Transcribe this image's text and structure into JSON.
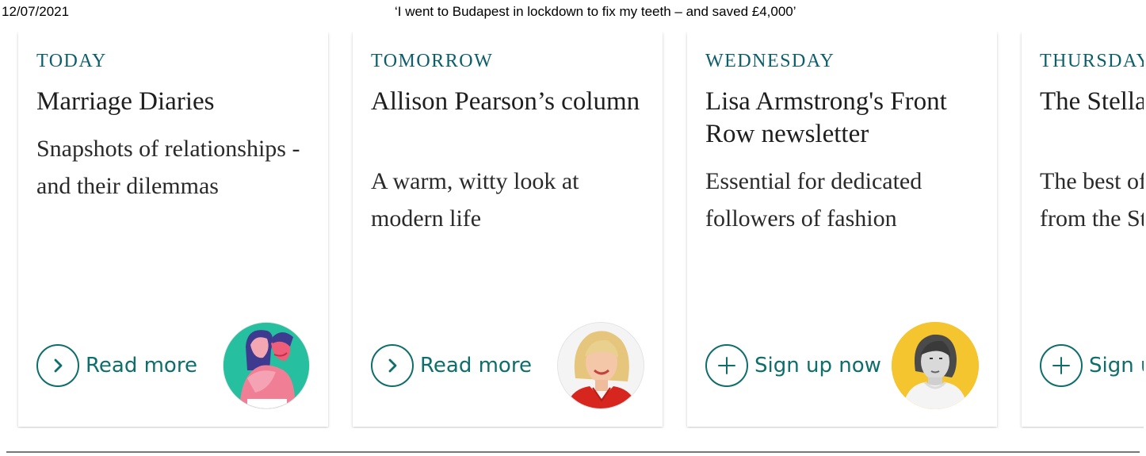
{
  "print_header": {
    "date": "12/07/2021",
    "title": "‘I went to Budapest in lockdown to fix my teeth – and saved £4,000’"
  },
  "cards": [
    {
      "day": "TODAY",
      "title": "Marriage Diaries",
      "description": "Snapshots of relationships - and their dilemmas",
      "action": {
        "label": "Read more",
        "icon": "chevron-right-icon"
      },
      "avatar": "couple-illustration"
    },
    {
      "day": "TOMORROW",
      "title": "Allison Pearson’s column",
      "description": "A warm, witty look at modern life",
      "action": {
        "label": "Read more",
        "icon": "chevron-right-icon"
      },
      "avatar": "allison-pearson-portrait"
    },
    {
      "day": "WEDNESDAY",
      "title": "Lisa Armstrong's Front Row newsletter",
      "description": "Essential for dedicated followers of fashion",
      "action": {
        "label": "Sign up now",
        "icon": "plus-icon"
      },
      "avatar": "lisa-armstrong-portrait"
    },
    {
      "day": "THURSDAY",
      "title": "The Stella newsletter",
      "description": "The best of beauty, travel from the Stella magazine",
      "action": {
        "label": "Sign up now",
        "icon": "plus-icon"
      },
      "avatar": ""
    }
  ],
  "colors": {
    "accent_teal": "#0d6e6b",
    "day_label": "#0d5e6b",
    "card_background": "#ffffff"
  }
}
